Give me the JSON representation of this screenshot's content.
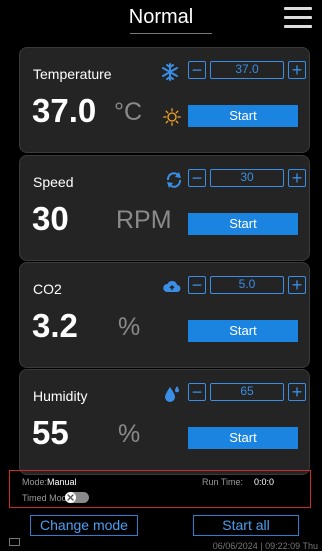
{
  "header": {
    "title": "Normal",
    "menu_icon": "hamburger-menu-icon"
  },
  "cards": {
    "temperature": {
      "label": "Temperature",
      "value": "37.0",
      "unit": "°C",
      "setpoint": "37.0",
      "start_label": "Start",
      "icons": [
        "snowflake-icon",
        "sun-icon"
      ]
    },
    "speed": {
      "label": "Speed",
      "value": "30",
      "unit": "RPM",
      "setpoint": "30",
      "start_label": "Start",
      "icons": [
        "rotate-icon"
      ]
    },
    "co2": {
      "label": "CO2",
      "value": "3.2",
      "unit": "%",
      "setpoint": "5.0",
      "start_label": "Start",
      "icons": [
        "cloud-upload-icon"
      ]
    },
    "humidity": {
      "label": "Humidity",
      "value": "55",
      "unit": "%",
      "setpoint": "65",
      "start_label": "Start",
      "icons": [
        "water-drop-icon"
      ]
    }
  },
  "stepper": {
    "minus": "−",
    "plus": "+"
  },
  "status": {
    "mode_label": "Mode:",
    "mode_value": "Manual",
    "runtime_label": "Run Time:",
    "runtime_value": "0:0:0",
    "timed_label": "Timed Mode:",
    "timed_enabled": false
  },
  "footer": {
    "change_mode_label": "Change mode",
    "start_all_label": "Start all",
    "datetime": "06/06/2024 | 09:22:09 Thu"
  },
  "colors": {
    "accent": "#1b84e0",
    "status_border": "#cc2a2a",
    "card_bg": "#242424"
  }
}
